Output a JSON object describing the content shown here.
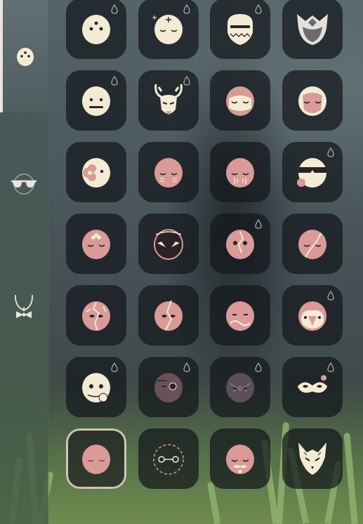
{
  "screen": "mask-wardrobe",
  "colors": {
    "mask_cream": "#f3ebd4",
    "mask_pink": "#d99a98",
    "mask_dark": "#2a2226",
    "slot_bg": "#1a1e22",
    "selected_ring": "#cfc5b4",
    "sidebar_active": "#e9e6df"
  },
  "sidebar": {
    "tabs": [
      {
        "icon": "mask-face-icon",
        "active": true
      },
      {
        "icon": "sunglasses-icon",
        "active": false
      },
      {
        "icon": "necklace-bowtie-icon",
        "active": false
      }
    ]
  },
  "masks": [
    [
      {
        "icon": "cream-three-dot-mask-icon",
        "drop": true,
        "selected": false
      },
      {
        "icon": "cream-sleepy-sparkle-mask-icon",
        "drop": true,
        "selected": false
      },
      {
        "icon": "cream-bearded-mask-icon",
        "drop": true,
        "selected": false
      },
      {
        "icon": "dark-horned-oni-mask-icon",
        "drop": false,
        "selected": false
      }
    ],
    [
      {
        "icon": "cream-line-mouth-mask-icon",
        "drop": true,
        "selected": false
      },
      {
        "icon": "cream-antler-mask-icon",
        "drop": true,
        "selected": false
      },
      {
        "icon": "pink-hood-mask-icon",
        "drop": false,
        "selected": false
      },
      {
        "icon": "pink-cream-hood-mask-icon",
        "drop": false,
        "selected": false
      }
    ],
    [
      {
        "icon": "cream-flower-mask-icon",
        "drop": false,
        "selected": false
      },
      {
        "icon": "pink-tear-marks-mask-icon",
        "drop": false,
        "selected": false
      },
      {
        "icon": "pink-sad-mask-icon",
        "drop": false,
        "selected": false
      },
      {
        "icon": "cream-banded-mask-icon",
        "drop": true,
        "selected": false
      }
    ],
    [
      {
        "icon": "pink-flower-crown-mask-icon",
        "drop": false,
        "selected": false
      },
      {
        "icon": "dark-fierce-eyes-mask-icon",
        "drop": false,
        "selected": false
      },
      {
        "icon": "pink-cracked-eye-mask-icon",
        "drop": true,
        "selected": false
      },
      {
        "icon": "pink-crack-line-mask-icon",
        "drop": false,
        "selected": false
      }
    ],
    [
      {
        "icon": "pink-shattered-mask-icon",
        "drop": false,
        "selected": false
      },
      {
        "icon": "pink-split-mask-icon",
        "drop": false,
        "selected": false
      },
      {
        "icon": "pink-wave-mouth-mask-icon",
        "drop": false,
        "selected": false
      },
      {
        "icon": "pink-beak-mask-icon",
        "drop": true,
        "selected": false
      }
    ],
    [
      {
        "icon": "cream-skull-rose-mask-icon",
        "drop": true,
        "selected": false
      },
      {
        "icon": "dark-monocle-mask-icon",
        "drop": true,
        "selected": false
      },
      {
        "icon": "dark-pattern-mask-icon",
        "drop": true,
        "selected": false
      },
      {
        "icon": "cream-masquerade-mask-icon",
        "drop": true,
        "selected": false
      }
    ],
    [
      {
        "icon": "pink-plain-sleepy-mask-icon",
        "drop": false,
        "selected": true
      },
      {
        "icon": "dark-dashed-circle-mask-icon",
        "drop": false,
        "selected": false
      },
      {
        "icon": "pink-mustache-mask-icon",
        "drop": false,
        "selected": false
      },
      {
        "icon": "cream-fox-mask-icon",
        "drop": false,
        "selected": false
      }
    ]
  ]
}
